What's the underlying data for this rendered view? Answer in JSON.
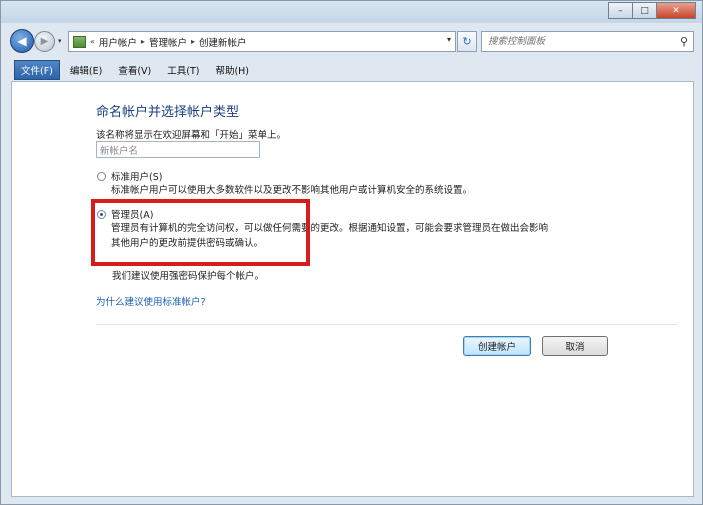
{
  "window": {
    "min_glyph": "–",
    "max_glyph": "□",
    "close_glyph": "✕"
  },
  "nav": {
    "back_glyph": "◀",
    "forward_glyph": "▶",
    "history_glyph": "▾",
    "breadcrumb_prefix": "«",
    "breadcrumbs": [
      "用户帐户",
      "管理帐户",
      "创建新帐户"
    ],
    "separator": "▸",
    "address_drop_glyph": "▾",
    "refresh_glyph": "↻",
    "search_placeholder": "搜索控制面板",
    "search_glyph": "⚲"
  },
  "menu": [
    "文件(F)",
    "编辑(E)",
    "查看(V)",
    "工具(T)",
    "帮助(H)"
  ],
  "page": {
    "heading": "命名帐户并选择帐户类型",
    "description": "该名称将显示在欢迎屏幕和「开始」菜单上。",
    "name_value": "新帐户名",
    "standard": {
      "label": "标准用户(S)",
      "desc": "标准帐户用户可以使用大多数软件以及更改不影响其他用户或计算机安全的系统设置。"
    },
    "admin": {
      "label": "管理员(A)",
      "desc_line1": "管理员有计算机的完全访问权，可以做任何需要的更改。根据通知设置，可能会要求管理员在做出会影响",
      "desc_line2": "其他用户的更改前提供密码或确认。"
    },
    "recommend": "我们建议使用强密码保护每个帐户。",
    "why_link": "为什么建议使用标准帐户?"
  },
  "buttons": {
    "create": "创建帐户",
    "cancel": "取消"
  },
  "colors": {
    "highlight": "#d81c1c",
    "heading": "#1c3f82",
    "link": "#1a5fb4"
  }
}
